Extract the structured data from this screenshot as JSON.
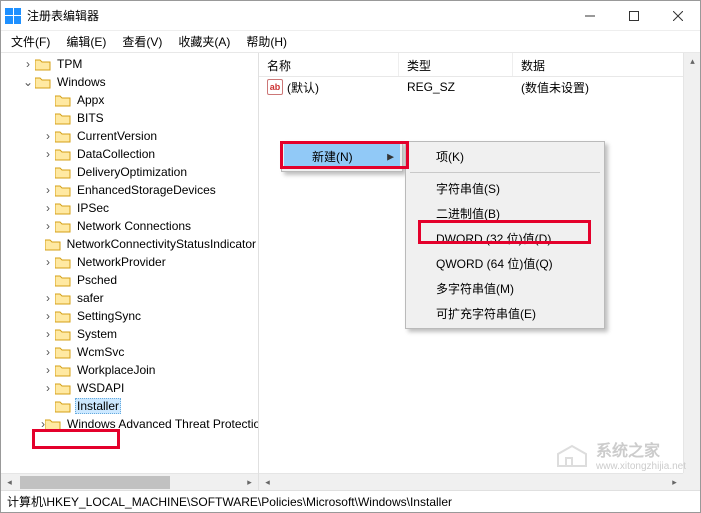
{
  "title": "注册表编辑器",
  "menus": {
    "file": "文件(F)",
    "edit": "编辑(E)",
    "view": "查看(V)",
    "fav": "收藏夹(A)",
    "help": "帮助(H)"
  },
  "tree": {
    "tpm": "TPM",
    "windows": "Windows",
    "children": {
      "appx": "Appx",
      "bits": "BITS",
      "currentversion": "CurrentVersion",
      "datacollection": "DataCollection",
      "deliveryopt": "DeliveryOptimization",
      "enhancedstorage": "EnhancedStorageDevices",
      "ipsec": "IPSec",
      "netconn": "Network Connections",
      "netconnstatus": "NetworkConnectivityStatusIndicator",
      "netprovider": "NetworkProvider",
      "psched": "Psched",
      "safer": "safer",
      "settingsync": "SettingSync",
      "system": "System",
      "wcmsvc": "WcmSvc",
      "workplacejoin": "WorkplaceJoin",
      "wsdapi": "WSDAPI",
      "installer": "Installer",
      "watp": "Windows Advanced Threat Protection"
    }
  },
  "list": {
    "headers": {
      "name": "名称",
      "type": "类型",
      "data": "数据"
    },
    "default_row": {
      "name": "(默认)",
      "type": "REG_SZ",
      "data": "(数值未设置)"
    }
  },
  "context1": {
    "new": "新建(N)"
  },
  "context2": {
    "key": "项(K)",
    "string": "字符串值(S)",
    "binary": "二进制值(B)",
    "dword": "DWORD (32 位)值(D)",
    "qword": "QWORD (64 位)值(Q)",
    "multi": "多字符串值(M)",
    "expand": "可扩充字符串值(E)"
  },
  "status": "计算机\\HKEY_LOCAL_MACHINE\\SOFTWARE\\Policies\\Microsoft\\Windows\\Installer",
  "watermark": "系统之家",
  "watermark_url": "www.xitongzhijia.net"
}
